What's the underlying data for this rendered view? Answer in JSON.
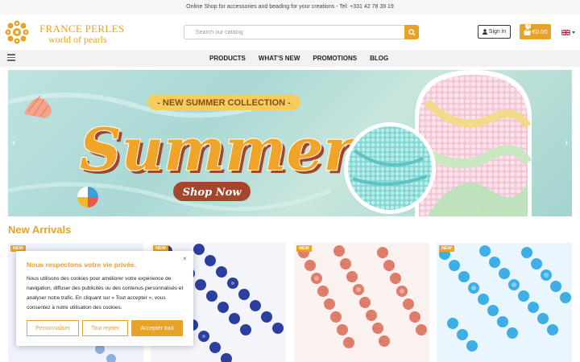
{
  "topbar": {
    "text": "Online Shop for accessories and beading for your creations - Tel: +331 42 78 39 19"
  },
  "brand": {
    "name": "FRANCE PERLES",
    "tagline": "world of pearls"
  },
  "search": {
    "placeholder": "Search our catalog",
    "icon": "search-icon"
  },
  "account": {
    "signin_label": "Sign in",
    "icon": "user-icon"
  },
  "cart": {
    "total": "€0.00",
    "count": "0",
    "icon": "basket-icon"
  },
  "language": {
    "icon": "uk-flag-icon"
  },
  "nav": {
    "items": [
      "PRODUCTS",
      "WHAT'S NEW",
      "PROMOTIONS",
      "BLOG"
    ]
  },
  "banner": {
    "pill": "- NEW SUMMER COLLECTION -",
    "headline": "Summer",
    "cta": "Shop Now",
    "prev": "‹",
    "next": "›"
  },
  "new_arrivals": {
    "title": "New Arrivals",
    "badge": "NEW",
    "products": [
      {
        "name": "light-blue-faceted-beads"
      },
      {
        "name": "dark-blue-faceted-beads"
      },
      {
        "name": "pink-orange-faceted-beads"
      },
      {
        "name": "sky-blue-faceted-beads"
      }
    ]
  },
  "cookie": {
    "close": "×",
    "title": "Nous respectons votre vie privée.",
    "text": "Nous utilisons des cookies pour améliorer votre expérience de navigation, diffuser des publicités ou des contenus personnalisés et analyser notre trafic. En cliquant sur « Tout accepter », vous consentez à notre utilisation des cookies.",
    "customize": "Personnaliser",
    "reject": "Tout rejeter",
    "accept": "Accepter tout"
  },
  "colors": {
    "accent": "#e8a227",
    "cta_brown": "#a4462c",
    "headline_orange": "#f0a52a"
  }
}
